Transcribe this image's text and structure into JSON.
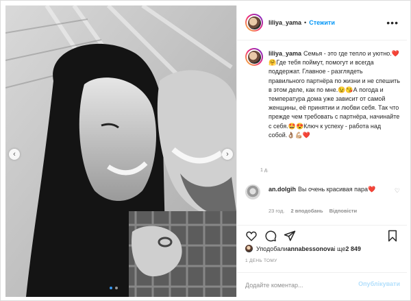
{
  "post": {
    "username": "liliya_yama",
    "separator": "•",
    "follow_label": "Стежити",
    "more_icon": "more-horizontal-icon",
    "caption": "Семья - это где тепло и уютно.❤️🤗Где тебя поймут, помогут и всегда поддержат. Главное - разглядеть правильного партнёра по жизни и не спешить в этом деле, как по мне.😉😘А погода и температура дома уже зависит от самой женщины, её принятии и любви себя. Так что прежде чем требовать с партнёра, начинайте с себя.🤩😍Ключ к успеху - работа над собой.👌🏽💪🏼❤️",
    "caption_age": "1 д.",
    "comment": {
      "username": "an.dolgih",
      "text": "Вы очень красивая пара❤️",
      "age": "23 год.",
      "likes": "2 вподобань",
      "reply": "Відповісти"
    },
    "likes_line": {
      "prefix": "Уподобали ",
      "user": "annabessonova",
      "middle": " і ще ",
      "count": "2 849"
    },
    "date": "1 ДЕНЬ ТОМУ",
    "add_comment_placeholder": "Додайте коментар...",
    "post_button": "Опублікувати",
    "carousel": {
      "slides": 2,
      "current": 1
    },
    "accent": "#0095f6"
  }
}
